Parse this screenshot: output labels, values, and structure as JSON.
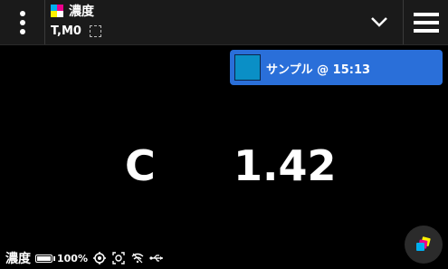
{
  "header": {
    "title": "濃度",
    "mode": "T,M0"
  },
  "sample": {
    "label": "サンプル @ 15:13",
    "color": "#0a8fc6"
  },
  "measurement": {
    "channel": "C",
    "value": "1.42"
  },
  "status": {
    "title": "濃度",
    "battery": "100%",
    "battery_level": 1.0
  },
  "colors": {
    "topbar_bg": "#1a1a1a",
    "card_bg": "#2a6fd9"
  },
  "icons": [
    "kebab-menu-icon",
    "cmyk-icon",
    "dashed-square-icon",
    "chevron-down-icon",
    "hamburger-menu-icon",
    "battery-icon",
    "target-icon",
    "aperture-icon",
    "wifi-icon",
    "usb-icon",
    "color-layers-icon"
  ]
}
